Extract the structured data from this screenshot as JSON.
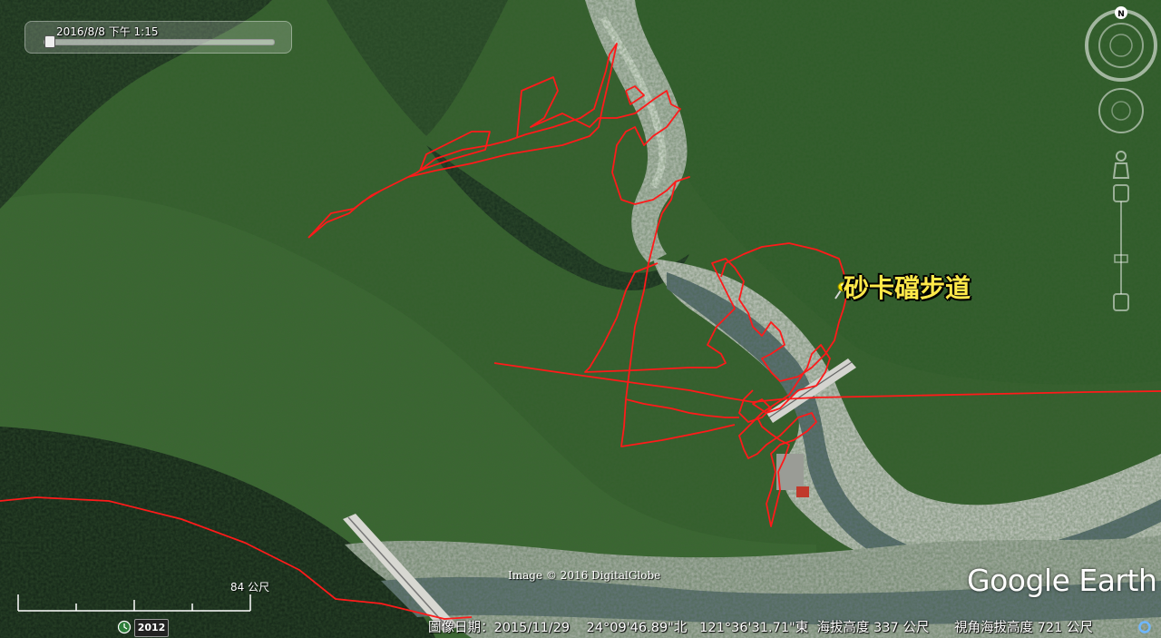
{
  "time_slider": {
    "label": "2016/8/8 下午   1:15"
  },
  "placemark": {
    "label": "砂卡礑步道"
  },
  "navigation": {
    "north_label": "N"
  },
  "scale_bar": {
    "label": "84 公尺"
  },
  "copyright": "Image © 2016 DigitalGlobe",
  "logo": "Google Earth",
  "historical_imagery": {
    "year": "2012"
  },
  "status_bar": {
    "imagery_date": "圖像日期：2015/11/29",
    "latitude": "24°09'46.89\"北",
    "longitude": "121°36'31.71\"東",
    "elevation": "海拔高度   337 公尺",
    "eye_altitude": "視角海拔高度    721 公尺"
  },
  "colors": {
    "track": "#ff1a1a",
    "placemark_label": "#ffe94a",
    "pin": "#f2e200"
  },
  "icons": [
    "time-slider",
    "placemark-pushpin-icon",
    "compass-icon",
    "look-joystick-icon",
    "street-view-pegman-icon",
    "zoom-slider",
    "history-clock-icon",
    "streaming-status-icon"
  ]
}
